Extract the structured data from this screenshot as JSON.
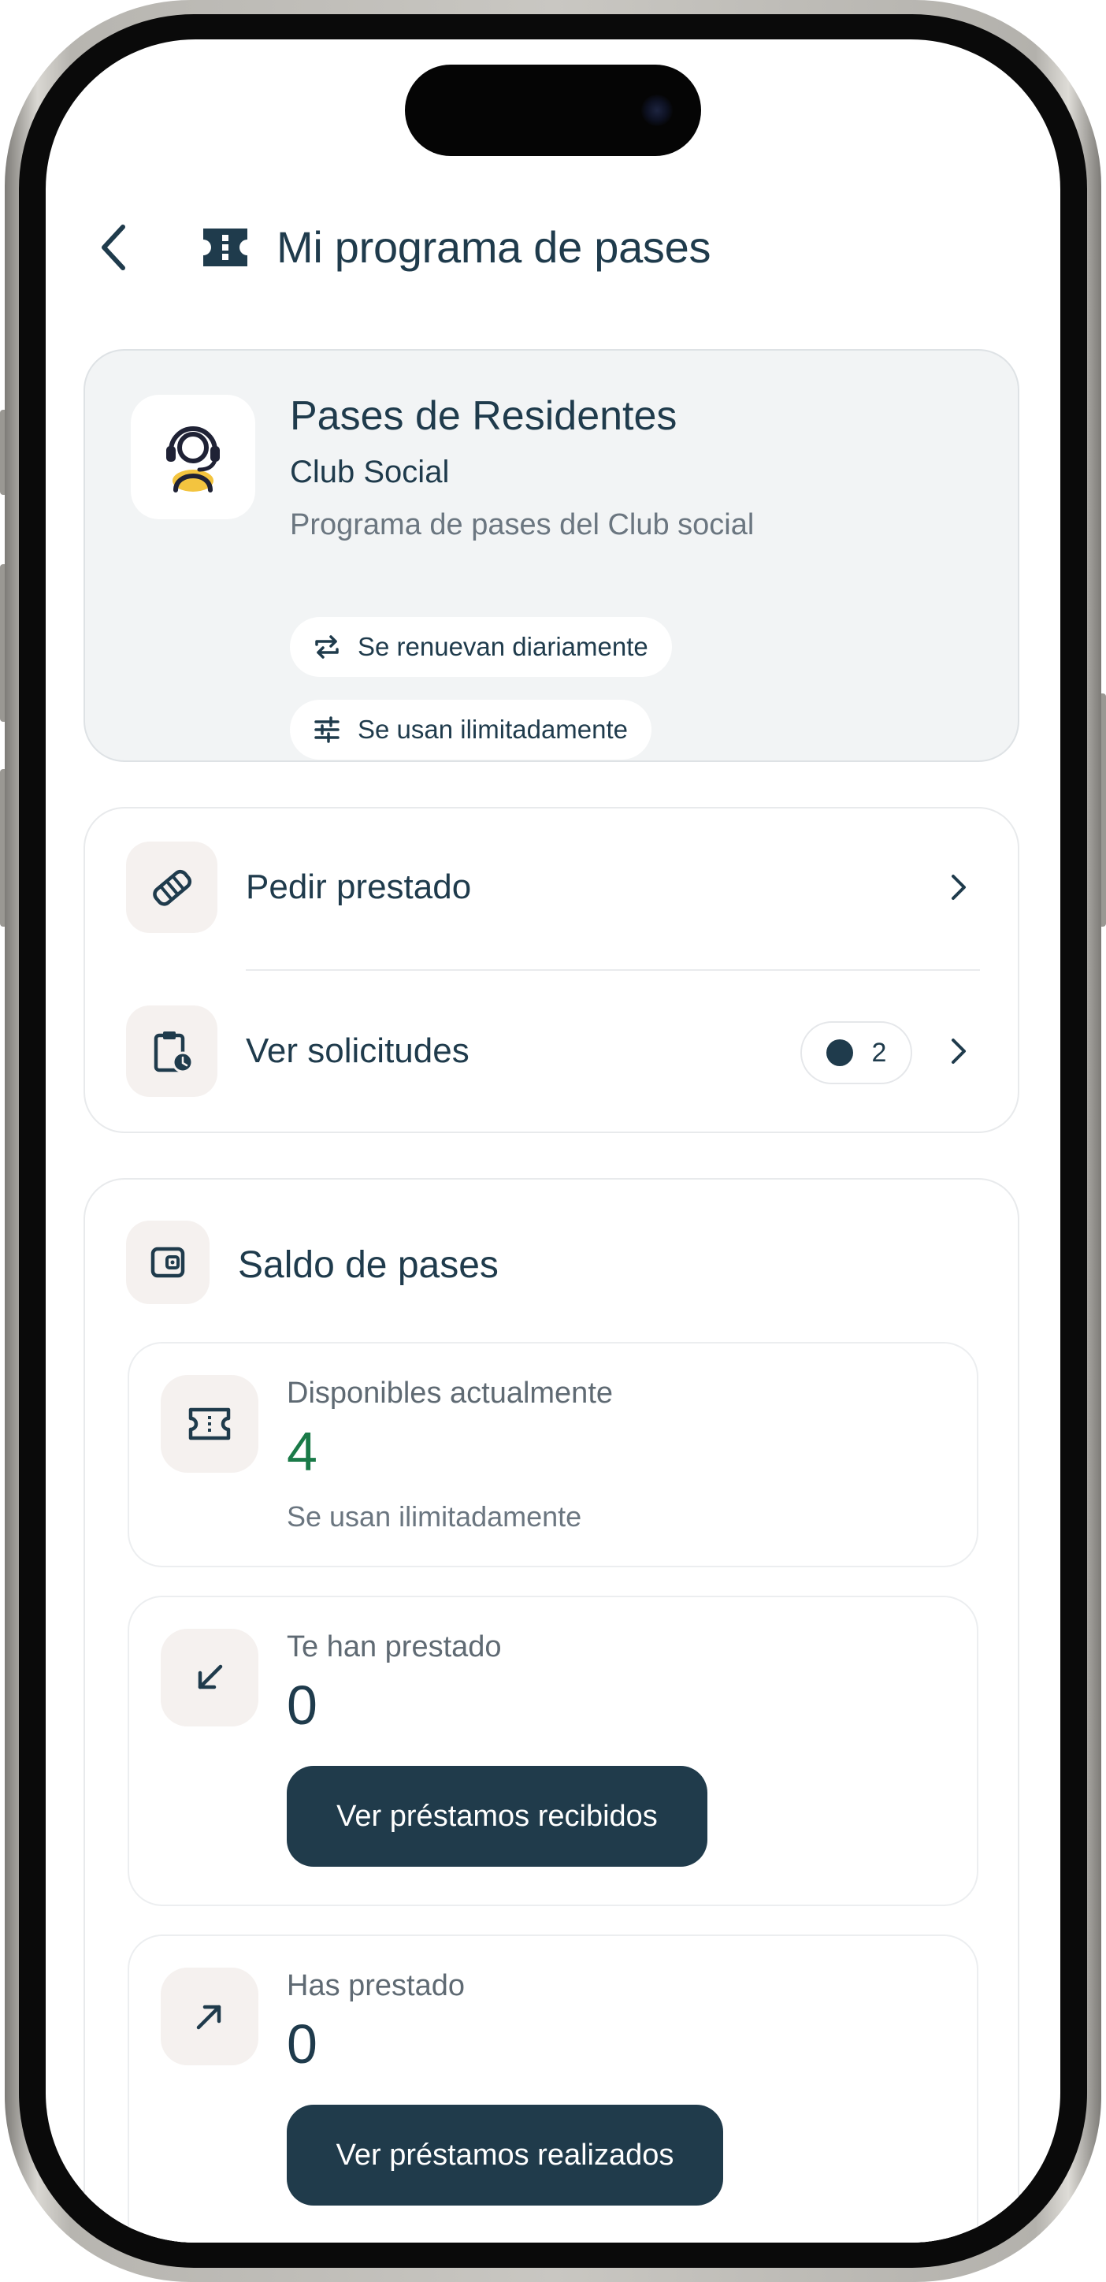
{
  "header": {
    "title": "Mi programa de pases"
  },
  "program": {
    "title": "Pases de Residentes",
    "subtitle": "Club Social",
    "description": "Programa de pases del Club social",
    "tags": [
      "Se renuevan diariamente",
      "Se usan ilimitadamente"
    ]
  },
  "actions": {
    "borrow_label": "Pedir prestado",
    "requests_label": "Ver solicitudes",
    "requests_count": "2"
  },
  "balance": {
    "title": "Saldo de pases",
    "available": {
      "label": "Disponibles actualmente",
      "value": "4",
      "note": "Se usan ilimitadamente"
    },
    "received": {
      "label": "Te han prestado",
      "value": "0",
      "button": "Ver préstamos recibidos"
    },
    "lent": {
      "label": "Has prestado",
      "value": "0",
      "button": "Ver préstamos realizados"
    }
  },
  "colors": {
    "primary": "#1f3b4c",
    "button": "#203b4b",
    "available_value": "#1a7a48",
    "icon_tile": "#f5f1ef",
    "logo_accent": "#f3c43f"
  }
}
